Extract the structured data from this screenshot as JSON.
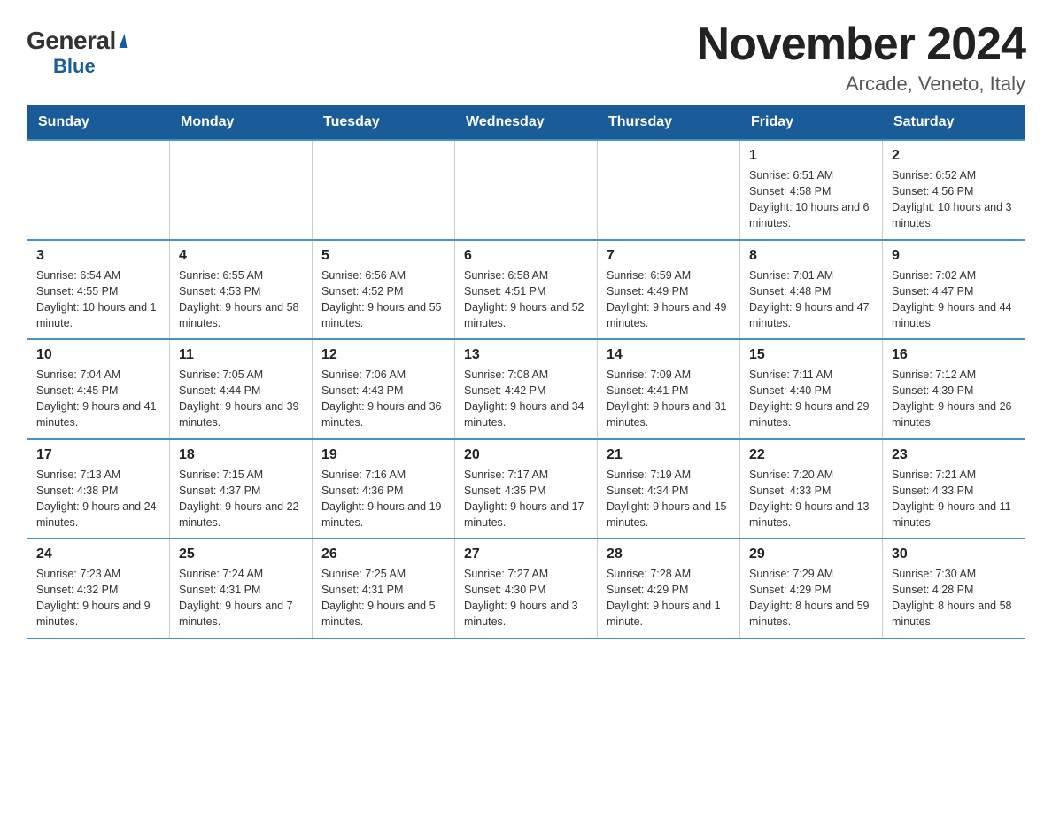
{
  "header": {
    "logo_general": "General",
    "logo_blue": "Blue",
    "month_title": "November 2024",
    "location": "Arcade, Veneto, Italy"
  },
  "weekdays": [
    "Sunday",
    "Monday",
    "Tuesday",
    "Wednesday",
    "Thursday",
    "Friday",
    "Saturday"
  ],
  "weeks": [
    [
      {
        "day": "",
        "info": ""
      },
      {
        "day": "",
        "info": ""
      },
      {
        "day": "",
        "info": ""
      },
      {
        "day": "",
        "info": ""
      },
      {
        "day": "",
        "info": ""
      },
      {
        "day": "1",
        "info": "Sunrise: 6:51 AM\nSunset: 4:58 PM\nDaylight: 10 hours and 6 minutes."
      },
      {
        "day": "2",
        "info": "Sunrise: 6:52 AM\nSunset: 4:56 PM\nDaylight: 10 hours and 3 minutes."
      }
    ],
    [
      {
        "day": "3",
        "info": "Sunrise: 6:54 AM\nSunset: 4:55 PM\nDaylight: 10 hours and 1 minute."
      },
      {
        "day": "4",
        "info": "Sunrise: 6:55 AM\nSunset: 4:53 PM\nDaylight: 9 hours and 58 minutes."
      },
      {
        "day": "5",
        "info": "Sunrise: 6:56 AM\nSunset: 4:52 PM\nDaylight: 9 hours and 55 minutes."
      },
      {
        "day": "6",
        "info": "Sunrise: 6:58 AM\nSunset: 4:51 PM\nDaylight: 9 hours and 52 minutes."
      },
      {
        "day": "7",
        "info": "Sunrise: 6:59 AM\nSunset: 4:49 PM\nDaylight: 9 hours and 49 minutes."
      },
      {
        "day": "8",
        "info": "Sunrise: 7:01 AM\nSunset: 4:48 PM\nDaylight: 9 hours and 47 minutes."
      },
      {
        "day": "9",
        "info": "Sunrise: 7:02 AM\nSunset: 4:47 PM\nDaylight: 9 hours and 44 minutes."
      }
    ],
    [
      {
        "day": "10",
        "info": "Sunrise: 7:04 AM\nSunset: 4:45 PM\nDaylight: 9 hours and 41 minutes."
      },
      {
        "day": "11",
        "info": "Sunrise: 7:05 AM\nSunset: 4:44 PM\nDaylight: 9 hours and 39 minutes."
      },
      {
        "day": "12",
        "info": "Sunrise: 7:06 AM\nSunset: 4:43 PM\nDaylight: 9 hours and 36 minutes."
      },
      {
        "day": "13",
        "info": "Sunrise: 7:08 AM\nSunset: 4:42 PM\nDaylight: 9 hours and 34 minutes."
      },
      {
        "day": "14",
        "info": "Sunrise: 7:09 AM\nSunset: 4:41 PM\nDaylight: 9 hours and 31 minutes."
      },
      {
        "day": "15",
        "info": "Sunrise: 7:11 AM\nSunset: 4:40 PM\nDaylight: 9 hours and 29 minutes."
      },
      {
        "day": "16",
        "info": "Sunrise: 7:12 AM\nSunset: 4:39 PM\nDaylight: 9 hours and 26 minutes."
      }
    ],
    [
      {
        "day": "17",
        "info": "Sunrise: 7:13 AM\nSunset: 4:38 PM\nDaylight: 9 hours and 24 minutes."
      },
      {
        "day": "18",
        "info": "Sunrise: 7:15 AM\nSunset: 4:37 PM\nDaylight: 9 hours and 22 minutes."
      },
      {
        "day": "19",
        "info": "Sunrise: 7:16 AM\nSunset: 4:36 PM\nDaylight: 9 hours and 19 minutes."
      },
      {
        "day": "20",
        "info": "Sunrise: 7:17 AM\nSunset: 4:35 PM\nDaylight: 9 hours and 17 minutes."
      },
      {
        "day": "21",
        "info": "Sunrise: 7:19 AM\nSunset: 4:34 PM\nDaylight: 9 hours and 15 minutes."
      },
      {
        "day": "22",
        "info": "Sunrise: 7:20 AM\nSunset: 4:33 PM\nDaylight: 9 hours and 13 minutes."
      },
      {
        "day": "23",
        "info": "Sunrise: 7:21 AM\nSunset: 4:33 PM\nDaylight: 9 hours and 11 minutes."
      }
    ],
    [
      {
        "day": "24",
        "info": "Sunrise: 7:23 AM\nSunset: 4:32 PM\nDaylight: 9 hours and 9 minutes."
      },
      {
        "day": "25",
        "info": "Sunrise: 7:24 AM\nSunset: 4:31 PM\nDaylight: 9 hours and 7 minutes."
      },
      {
        "day": "26",
        "info": "Sunrise: 7:25 AM\nSunset: 4:31 PM\nDaylight: 9 hours and 5 minutes."
      },
      {
        "day": "27",
        "info": "Sunrise: 7:27 AM\nSunset: 4:30 PM\nDaylight: 9 hours and 3 minutes."
      },
      {
        "day": "28",
        "info": "Sunrise: 7:28 AM\nSunset: 4:29 PM\nDaylight: 9 hours and 1 minute."
      },
      {
        "day": "29",
        "info": "Sunrise: 7:29 AM\nSunset: 4:29 PM\nDaylight: 8 hours and 59 minutes."
      },
      {
        "day": "30",
        "info": "Sunrise: 7:30 AM\nSunset: 4:28 PM\nDaylight: 8 hours and 58 minutes."
      }
    ]
  ]
}
